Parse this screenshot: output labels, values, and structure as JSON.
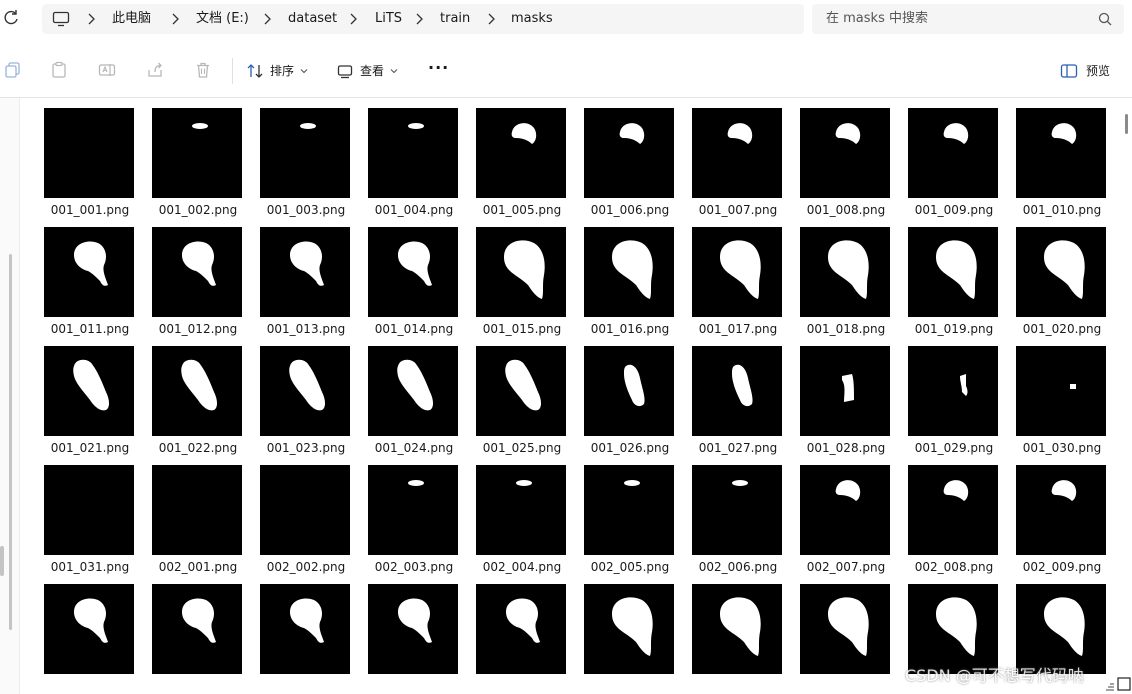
{
  "breadcrumb": [
    "此电脑",
    "文档 (E:)",
    "dataset",
    "LiTS",
    "train",
    "masks"
  ],
  "search": {
    "placeholder": "在 masks 中搜索"
  },
  "toolbar": {
    "sort_label": "排序",
    "view_label": "查看",
    "more_label": "···",
    "preview_label": "预览"
  },
  "files": [
    {
      "name": "001_001.png",
      "mask": "empty"
    },
    {
      "name": "001_002.png",
      "mask": "sliver"
    },
    {
      "name": "001_003.png",
      "mask": "sliver"
    },
    {
      "name": "001_004.png",
      "mask": "sliver"
    },
    {
      "name": "001_005.png",
      "mask": "small"
    },
    {
      "name": "001_006.png",
      "mask": "small"
    },
    {
      "name": "001_007.png",
      "mask": "small"
    },
    {
      "name": "001_008.png",
      "mask": "small"
    },
    {
      "name": "001_009.png",
      "mask": "small"
    },
    {
      "name": "001_010.png",
      "mask": "small"
    },
    {
      "name": "001_011.png",
      "mask": "medium"
    },
    {
      "name": "001_012.png",
      "mask": "medium"
    },
    {
      "name": "001_013.png",
      "mask": "medium"
    },
    {
      "name": "001_014.png",
      "mask": "medium"
    },
    {
      "name": "001_015.png",
      "mask": "large"
    },
    {
      "name": "001_016.png",
      "mask": "large"
    },
    {
      "name": "001_017.png",
      "mask": "large"
    },
    {
      "name": "001_018.png",
      "mask": "large"
    },
    {
      "name": "001_019.png",
      "mask": "large"
    },
    {
      "name": "001_020.png",
      "mask": "large"
    },
    {
      "name": "001_021.png",
      "mask": "lobe"
    },
    {
      "name": "001_022.png",
      "mask": "lobe"
    },
    {
      "name": "001_023.png",
      "mask": "lobe"
    },
    {
      "name": "001_024.png",
      "mask": "lobe"
    },
    {
      "name": "001_025.png",
      "mask": "lobe"
    },
    {
      "name": "001_026.png",
      "mask": "strip"
    },
    {
      "name": "001_027.png",
      "mask": "strip"
    },
    {
      "name": "001_028.png",
      "mask": "block"
    },
    {
      "name": "001_029.png",
      "mask": "tiny"
    },
    {
      "name": "001_030.png",
      "mask": "dot"
    },
    {
      "name": "001_031.png",
      "mask": "empty"
    },
    {
      "name": "002_001.png",
      "mask": "empty"
    },
    {
      "name": "002_002.png",
      "mask": "empty"
    },
    {
      "name": "002_003.png",
      "mask": "sliver"
    },
    {
      "name": "002_004.png",
      "mask": "sliver"
    },
    {
      "name": "002_005.png",
      "mask": "sliver"
    },
    {
      "name": "002_006.png",
      "mask": "sliver"
    },
    {
      "name": "002_007.png",
      "mask": "small"
    },
    {
      "name": "002_008.png",
      "mask": "small"
    },
    {
      "name": "002_009.png",
      "mask": "small"
    },
    {
      "name": "",
      "mask": "medium"
    },
    {
      "name": "",
      "mask": "medium"
    },
    {
      "name": "",
      "mask": "medium"
    },
    {
      "name": "",
      "mask": "medium"
    },
    {
      "name": "",
      "mask": "medium"
    },
    {
      "name": "",
      "mask": "large"
    },
    {
      "name": "",
      "mask": "large"
    },
    {
      "name": "",
      "mask": "large"
    },
    {
      "name": "",
      "mask": "large"
    },
    {
      "name": "",
      "mask": "large"
    }
  ],
  "watermark": "CSDN @可不想写代码呐"
}
